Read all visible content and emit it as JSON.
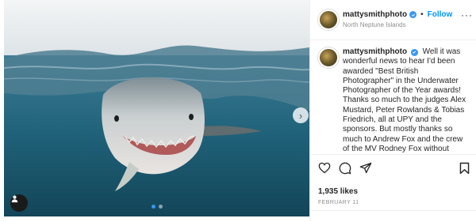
{
  "post": {
    "username": "mattysmithphoto",
    "separator": "•",
    "follow_label": "Follow",
    "location": "North Neptune Islands",
    "more_label": "···",
    "caption_username": "mattysmithphoto",
    "caption_text": "Well it was wonderful news to hear I'd been awarded \"Best British Photographer\" in the Underwater Photographer of the Year awards! Thanks so much to the judges Alex Mustard, Peter Rowlands & Tobias Friedrich, all at UPY and the sponsors. But mostly thanks so much to Andrew Fox and the crew of the MV Rodney Fox without whose participation this would not have been possible. It really was a",
    "likes": "1,935 likes",
    "date": "FEBRUARY 11"
  },
  "media": {
    "next_label": "›",
    "slide_count": 2,
    "active_slide": 1
  },
  "icons": {
    "verified": "verified-badge-icon",
    "like": "heart-icon",
    "comment": "comment-icon",
    "share": "paper-plane-icon",
    "save": "bookmark-icon",
    "user_tag": "user-tag-icon"
  },
  "colors": {
    "accent": "#0095f6",
    "verified": "#3897f0",
    "muted": "#8e8e8e",
    "text": "#262626"
  }
}
